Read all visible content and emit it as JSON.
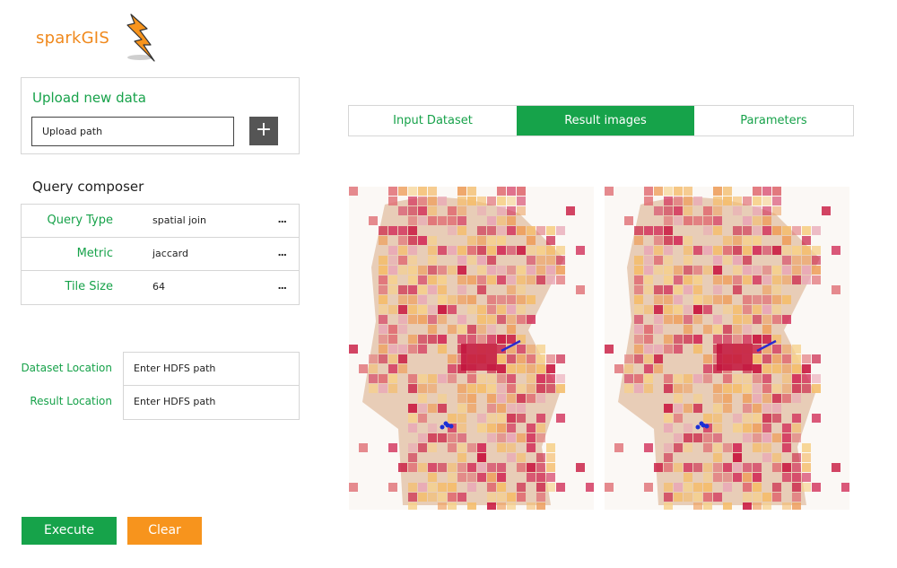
{
  "brand": {
    "name": "sparkGIS",
    "logo_icon": "lightning-bolt-icon",
    "color": "#f0891d"
  },
  "upload": {
    "title": "Upload new data",
    "input_value": "Upload path",
    "add_button": "+"
  },
  "query_composer": {
    "title": "Query composer",
    "rows": [
      {
        "label": "Query Type",
        "value": "spatial join",
        "more": "..."
      },
      {
        "label": "Metric",
        "value": "jaccard",
        "more": "..."
      },
      {
        "label": "Tile Size",
        "value": "64",
        "more": "..."
      }
    ]
  },
  "locations": {
    "dataset_label": "Dataset Location",
    "dataset_placeholder": "Enter HDFS path",
    "result_label": "Result Location",
    "result_placeholder": "Enter HDFS path"
  },
  "actions": {
    "execute": "Execute",
    "clear": "Clear"
  },
  "tabs": [
    {
      "label": "Input Dataset",
      "active": false
    },
    {
      "label": "Result images",
      "active": true
    },
    {
      "label": "Parameters",
      "active": false
    }
  ],
  "result_images": [
    "tissue-heatmap-image",
    "tissue-heatmap-image"
  ],
  "colors": {
    "accent_green": "#16a34a",
    "accent_orange": "#f7941d",
    "label_green": "#17a24a"
  }
}
